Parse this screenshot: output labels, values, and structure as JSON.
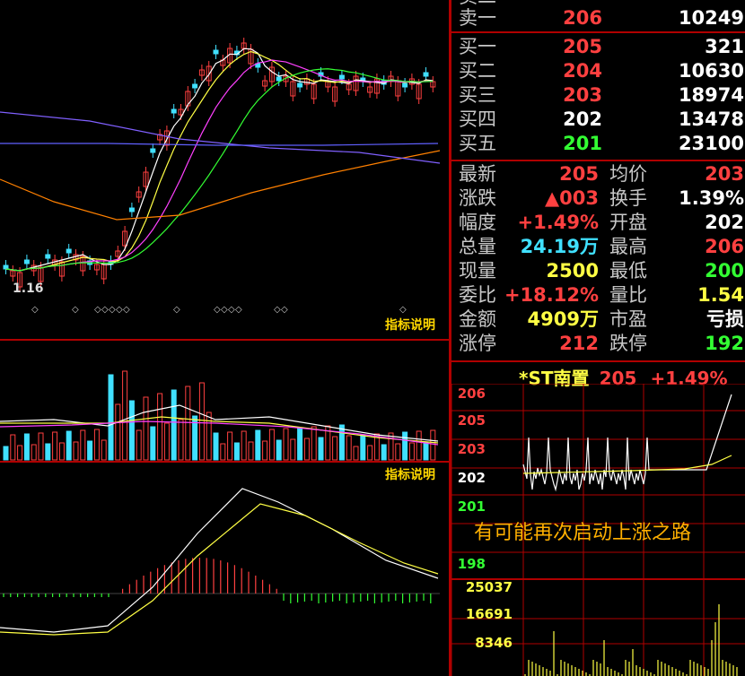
{
  "candle_chart": {
    "price_label": "1.16",
    "indicator_button": "指标说明"
  },
  "volume_chart": {
    "indicator_button": "指标说明"
  },
  "order_book": {
    "sell": [
      {
        "label": "卖二",
        "price": "",
        "volume": ""
      },
      {
        "label": "卖一",
        "price": "206",
        "volume": "10249"
      }
    ],
    "buy": [
      {
        "label": "买一",
        "price": "205",
        "volume": "321",
        "color": "#ff4040"
      },
      {
        "label": "买二",
        "price": "204",
        "volume": "10630",
        "color": "#ff4040"
      },
      {
        "label": "买三",
        "price": "203",
        "volume": "18974",
        "color": "#ff4040"
      },
      {
        "label": "买四",
        "price": "202",
        "volume": "13478",
        "color": "#ffffff"
      },
      {
        "label": "买五",
        "price": "201",
        "volume": "23100",
        "color": "#33ff33"
      }
    ]
  },
  "quote": {
    "rows": [
      {
        "l1": "最新",
        "v1": "205",
        "c1": "#ff4040",
        "l2": "均价",
        "v2": "203",
        "c2": "#ff4040"
      },
      {
        "l1": "涨跌",
        "v1": "▲003",
        "c1": "#ff4040",
        "l2": "换手",
        "v2": "1.39%",
        "c2": "#ffffff"
      },
      {
        "l1": "幅度",
        "v1": "+1.49%",
        "c1": "#ff4040",
        "l2": "开盘",
        "v2": "202",
        "c2": "#ffffff"
      },
      {
        "l1": "总量",
        "v1": "24.19万",
        "c1": "#40e0ff",
        "l2": "最高",
        "v2": "206",
        "c2": "#ff4040"
      },
      {
        "l1": "现量",
        "v1": "2500",
        "c1": "#ffff44",
        "l2": "最低",
        "v2": "200",
        "c2": "#33ff33"
      },
      {
        "l1": "委比",
        "v1": "+18.12%",
        "c1": "#ff4040",
        "l2": "量比",
        "v2": "1.54",
        "c2": "#ffff44"
      },
      {
        "l1": "金额",
        "v1": "4909万",
        "c1": "#ffff44",
        "l2": "市盈",
        "v2": "亏损",
        "c2": "#ffffff"
      },
      {
        "l1": "涨停",
        "v1": "212",
        "c1": "#ff4040",
        "l2": "跌停",
        "v2": "192",
        "c2": "#33ff33"
      }
    ]
  },
  "intraday": {
    "name": "*ST南置",
    "price": "205",
    "change": "+1.49%",
    "price_ticks": [
      {
        "v": "206",
        "color": "#ff4040"
      },
      {
        "v": "205",
        "color": "#ff4040"
      },
      {
        "v": "203",
        "color": "#ff4040"
      },
      {
        "v": "202",
        "color": "#ffffff"
      },
      {
        "v": "201",
        "color": "#33ff33"
      },
      {
        "v": "198",
        "color": "#33ff33"
      }
    ],
    "volume_ticks": [
      "25037",
      "16691",
      "8346"
    ],
    "annotation": "有可能再次启动上涨之路"
  },
  "colors": {
    "up": "#ff4040",
    "down": "#40e0ff",
    "grid": "#b00000"
  }
}
